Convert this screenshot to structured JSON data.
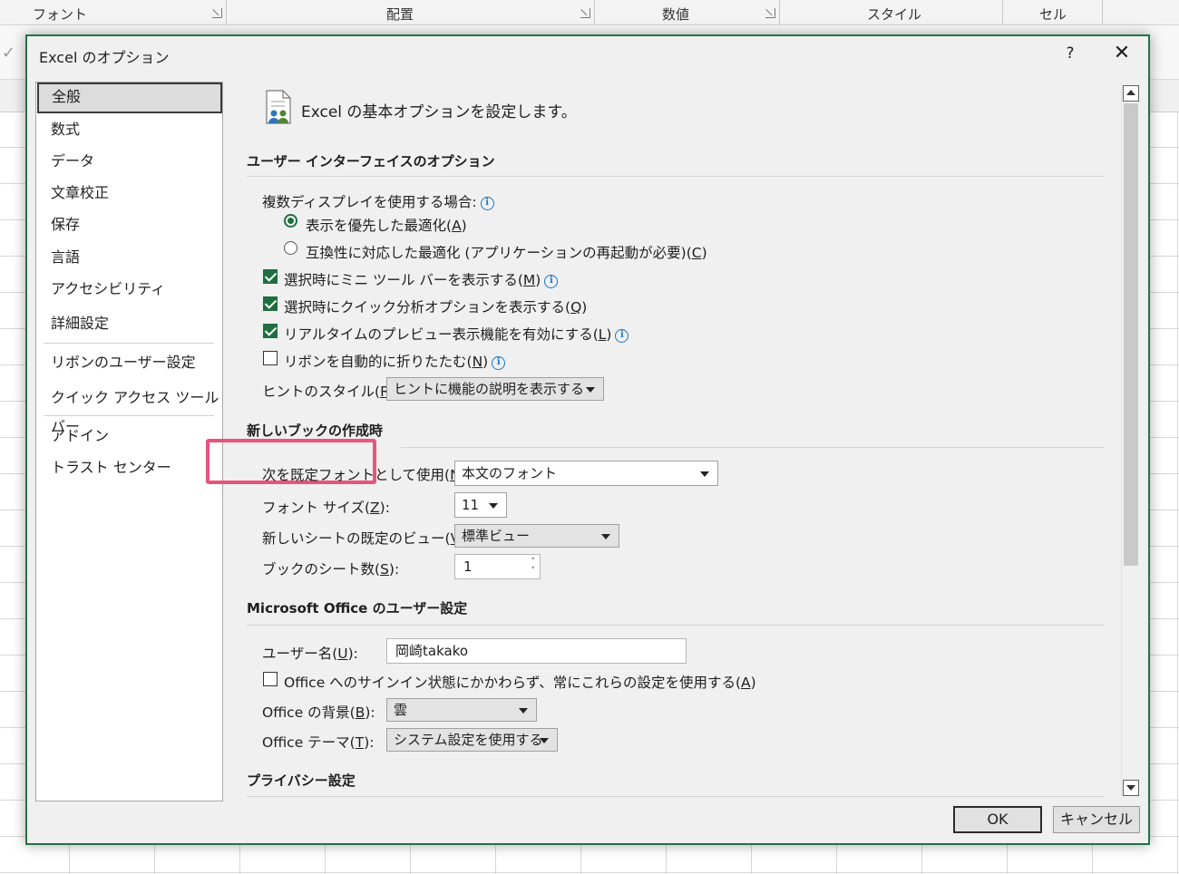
{
  "ribbon": {
    "groups": [
      "フォント",
      "配置",
      "数値",
      "スタイル",
      "セル"
    ]
  },
  "dialog": {
    "title": "Excel のオプション",
    "help": "?",
    "close": "✕"
  },
  "nav": {
    "items": [
      "全般",
      "数式",
      "データ",
      "文章校正",
      "保存",
      "言語",
      "アクセシビリティ",
      "詳細設定",
      "リボンのユーザー設定",
      "クイック アクセス ツール バー",
      "アドイン",
      "トラスト センター"
    ],
    "selected": "全般"
  },
  "content": {
    "header": "Excel の基本オプションを設定します。",
    "ui_section": {
      "title": "ユーザー インターフェイスのオプション",
      "multi_display_label": "複数ディスプレイを使用する場合:",
      "radio_optimize_display": {
        "text": "表示を優先した最適化(",
        "key": "A",
        "end": ")",
        "checked": true
      },
      "radio_optimize_compat": {
        "text": "互換性に対応した最適化 (アプリケーションの再起動が必要)(",
        "key": "C",
        "end": ")",
        "checked": false
      },
      "cb_mini_toolbar": {
        "text": "選択時にミニ ツール バーを表示する(",
        "key": "M",
        "end": ")",
        "checked": true
      },
      "cb_quick_analysis": {
        "text": "選択時にクイック分析オプションを表示する(",
        "key": "Q",
        "end": ")",
        "checked": true
      },
      "cb_live_preview": {
        "text": "リアルタイムのプレビュー表示機能を有効にする(",
        "key": "L",
        "end": ")",
        "checked": true
      },
      "cb_collapse_ribbon": {
        "text": "リボンを自動的に折りたたむ(",
        "key": "N",
        "end": ")",
        "checked": false
      },
      "tooltip_style_label": {
        "text": "ヒントのスタイル(",
        "key": "R",
        "end": "):"
      },
      "tooltip_style_value": "ヒントに機能の説明を表示する"
    },
    "new_book_section": {
      "title": "新しいブックの作成時",
      "default_font_label": {
        "text": "次を既定フォントとして使用(",
        "key": "N",
        "end": "):"
      },
      "default_font_value": "本文のフォント",
      "font_size_label": {
        "text": "フォント サイズ(",
        "key": "Z",
        "end": "):"
      },
      "font_size_value": "11",
      "default_view_label": {
        "text": "新しいシートの既定のビュー(",
        "key": "V",
        "end": "):"
      },
      "default_view_value": "標準ビュー",
      "sheet_count_label": {
        "text": "ブックのシート数(",
        "key": "S",
        "end": "):"
      },
      "sheet_count_value": "1"
    },
    "office_section": {
      "title": "Microsoft Office のユーザー設定",
      "username_label": {
        "text": "ユーザー名(",
        "key": "U",
        "end": "):"
      },
      "username_value": "岡崎takako",
      "cb_always_use": {
        "text": "Office へのサインイン状態にかかわらず、常にこれらの設定を使用する(",
        "key": "A",
        "end": ")",
        "checked": false
      },
      "background_label": {
        "text": "Office の背景(",
        "key": "B",
        "end": "):"
      },
      "background_value": "雲",
      "theme_label": {
        "text": "Office テーマ(",
        "key": "T",
        "end": "):"
      },
      "theme_value": "システム設定を使用する"
    },
    "privacy_section": {
      "title": "プライバシー設定"
    }
  },
  "buttons": {
    "ok": "OK",
    "cancel": "キャンセル"
  },
  "colors": {
    "accent_green": "#217346",
    "check_green": "#1f6e3f",
    "highlight_pink": "#e8547a",
    "info_blue": "#1a73c8"
  }
}
